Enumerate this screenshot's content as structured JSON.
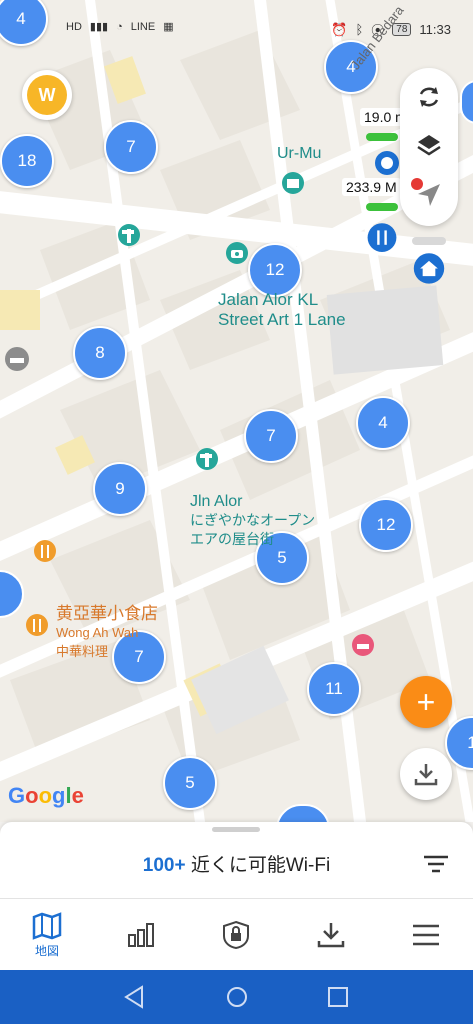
{
  "status_bar": {
    "left_icons": [
      "hd-icon",
      "signal-icon",
      "wifi-icon",
      "line-icon",
      "calendar-icon"
    ],
    "line_label": "LINE",
    "hd_label": "HD",
    "battery": "78",
    "time": "11:33"
  },
  "map": {
    "clusters": [
      "4",
      "4",
      "7",
      "18",
      "12",
      "8",
      "7",
      "4",
      "9",
      "12",
      "5",
      "7",
      "11",
      "5",
      "1"
    ],
    "street_label": "Jalan Bedara",
    "poi_ur_mu": "Ur-Mu",
    "poi_street_art": [
      "Jalan Alor KL",
      "Street Art 1 Lane"
    ],
    "poi_jln_alor": [
      "Jln Alor",
      "にぎやかなオープン",
      "エアの屋台街"
    ],
    "poi_restaurant": [
      "黄亞華小食店",
      "Wong Ah Wah",
      "中華料理"
    ],
    "speed_1": "19.0",
    "speed_1_unit": "m",
    "speed_2": "233.9",
    "speed_2_unit": "M",
    "google_logo": "Google",
    "colors": {
      "cluster": "#4a8ef0",
      "teal": "#1f8d8a",
      "orange": "#fa8c16",
      "accent": "#1c6fd1"
    }
  },
  "controls": {
    "refresh_icon": "refresh-icon",
    "layers_icon": "layers-icon",
    "locate_icon": "locate-icon",
    "fab_label": "+",
    "download_icon": "download-icon"
  },
  "bottom_sheet": {
    "count": "100+",
    "label": " 近くに可能Wi-Fi"
  },
  "tabs": [
    {
      "icon": "map-icon",
      "label": "地図"
    },
    {
      "icon": "chart-icon",
      "label": ""
    },
    {
      "icon": "lock-icon",
      "label": ""
    },
    {
      "icon": "download-icon",
      "label": ""
    },
    {
      "icon": "menu-icon",
      "label": ""
    }
  ]
}
